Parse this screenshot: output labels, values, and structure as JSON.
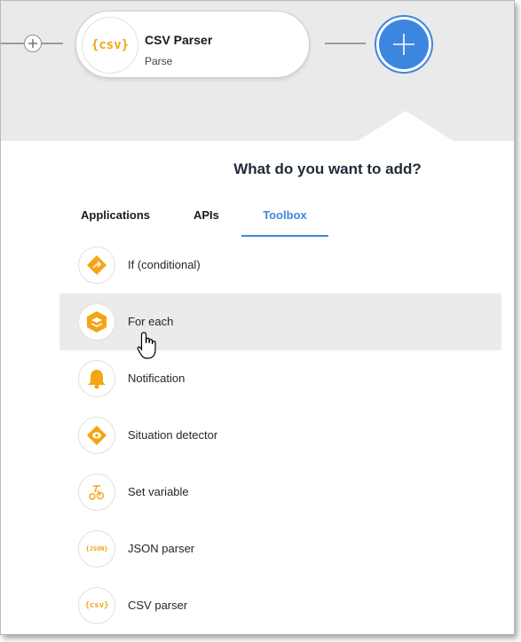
{
  "flow": {
    "node": {
      "icon_text": "{csv}",
      "title": "CSV Parser",
      "subtitle": "Parse"
    }
  },
  "panel": {
    "title": "What do you want to add?",
    "tabs": [
      {
        "label": "Applications",
        "active": false
      },
      {
        "label": "APIs",
        "active": false
      },
      {
        "label": "Toolbox",
        "active": true
      }
    ],
    "items": [
      {
        "label": "If (conditional)",
        "icon": "branch-icon"
      },
      {
        "label": "For each",
        "icon": "stack-icon",
        "hovered": true
      },
      {
        "label": "Notification",
        "icon": "bell-icon"
      },
      {
        "label": "Situation detector",
        "icon": "eye-icon"
      },
      {
        "label": "Set variable",
        "icon": "variable-icon"
      },
      {
        "label": "JSON parser",
        "icon": "json-icon",
        "badge": "{JSON}"
      },
      {
        "label": "CSV parser",
        "icon": "csv-icon",
        "badge": "{csv}"
      }
    ]
  },
  "colors": {
    "accent": "#3d86e0",
    "icon": "#f3a513",
    "header_bg": "#eaeaea"
  }
}
